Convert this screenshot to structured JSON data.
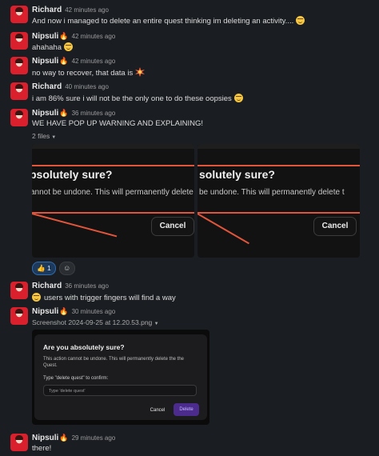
{
  "messages": [
    {
      "name": "Richard",
      "fire": false,
      "time": "42 minutes ago",
      "text": "And now i managed to delete an entire quest thinking im deleting an activity....",
      "emoji": "grin"
    },
    {
      "name": "Nipsuli",
      "fire": true,
      "time": "42 minutes ago",
      "text": "ahahaha",
      "emoji": "grin"
    },
    {
      "name": "Nipsuli",
      "fire": true,
      "time": "42 minutes ago",
      "text": "no way to recover, that data is",
      "emoji": "collision"
    },
    {
      "name": "Richard",
      "fire": false,
      "time": "40 minutes ago",
      "text": "i am 86% sure i will not be the only one to do these oopsies",
      "emoji": "sweat-smile"
    },
    {
      "name": "Nipsuli",
      "fire": true,
      "time": "36 minutes ago",
      "text": "WE HAVE POP UP WARNING AND EXPLAINING!",
      "emoji": ""
    },
    {
      "name": "Richard",
      "fire": false,
      "time": "36 minutes ago",
      "text": "users with trigger fingers will find a way",
      "emoji": "sweat-smile"
    },
    {
      "name": "Nipsuli",
      "fire": true,
      "time": "30 minutes ago",
      "text": "",
      "emoji": ""
    },
    {
      "name": "Nipsuli",
      "fire": true,
      "time": "29 minutes ago",
      "text": "there!",
      "emoji": ""
    }
  ],
  "fire_emoji": "🔥",
  "files_label": "2 files",
  "screenshot_crop": {
    "heading": "bsolutely sure?",
    "body": "annot be undone. This will permanently delete",
    "cancel": "Cancel"
  },
  "screenshot_crop_2": {
    "heading": "solutely sure?",
    "body": "be undone. This will permanently delete t",
    "cancel": "Cancel"
  },
  "reaction": {
    "emoji": "👍",
    "count": "1"
  },
  "file_name": "Screenshot 2024-09-25 at 12.20.53.png",
  "dialog": {
    "title": "Are you absolutely sure?",
    "body": "This action cannot be undone. This will permanently delete the the Quest.",
    "label": "Type \"delete quest\" to confirm:",
    "placeholder": "Type 'delete quest'",
    "cancel": "Cancel",
    "delete": "Delete"
  },
  "colors": {
    "background": "#1a1d21",
    "accent_line": "#e0553b",
    "delete_button": "#4b2c8c",
    "reaction_bg": "#1d3a5c"
  }
}
